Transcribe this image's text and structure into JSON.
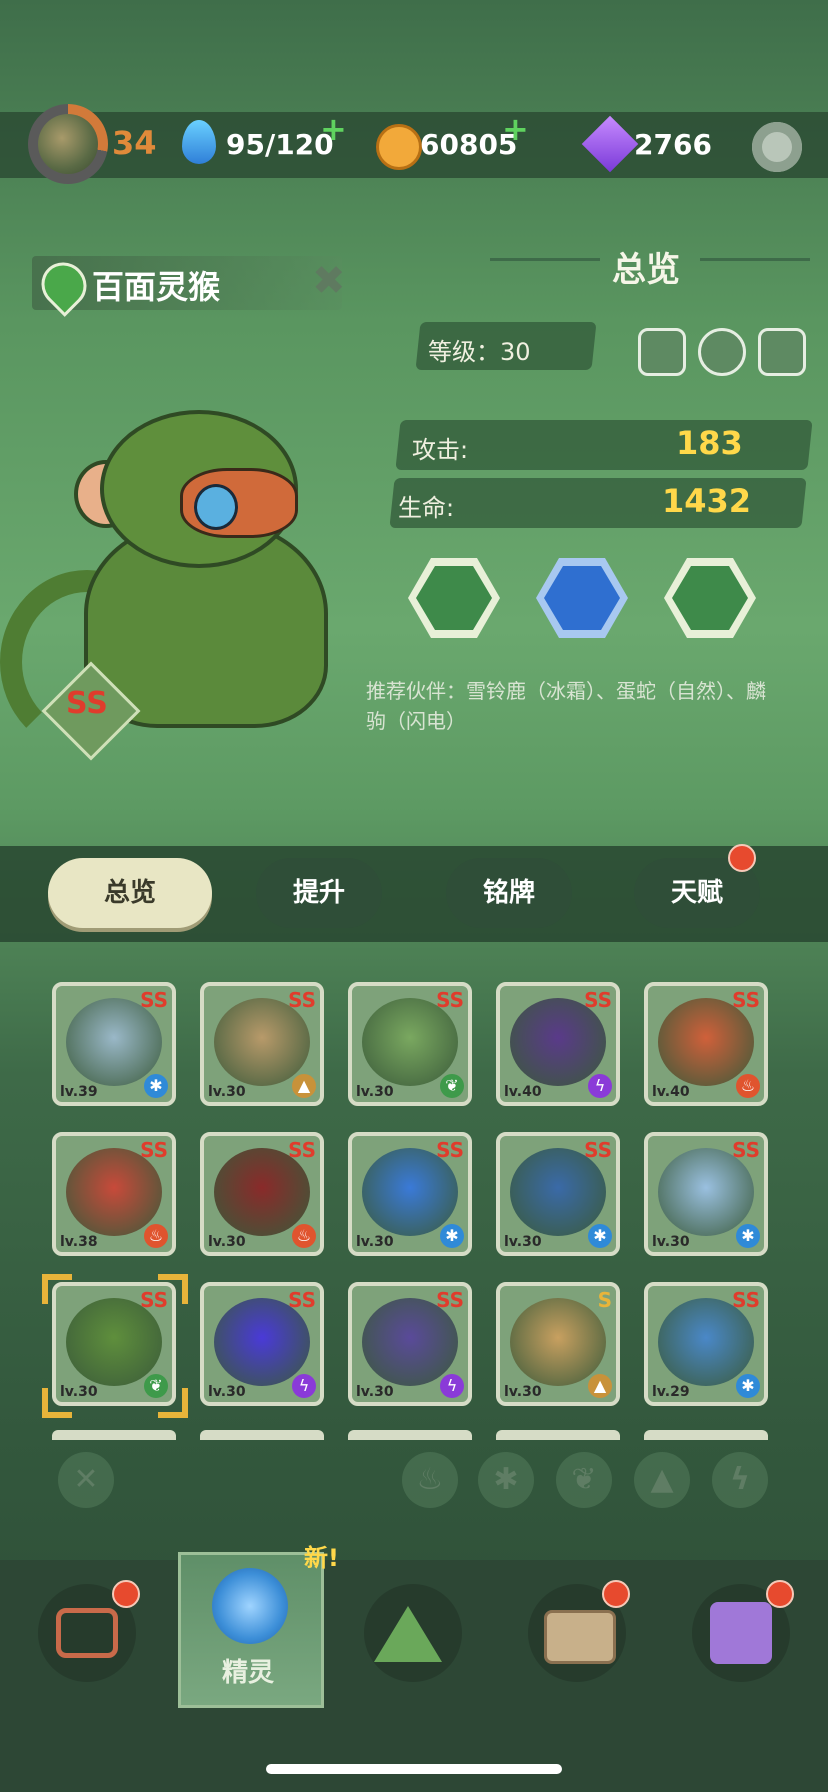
{
  "resources": {
    "level": "34",
    "stamina": "95/120",
    "coins": "60805",
    "gems": "2766"
  },
  "pet": {
    "name": "百面灵猴",
    "rank": "SS",
    "section_title": "总览",
    "level_label": "等级：30",
    "attack_label": "攻击:",
    "attack_value": "183",
    "hp_label": "生命:",
    "hp_value": "1432",
    "partners": "推荐伙伴：雪铃鹿（冰霜）、蛋蛇（自然）、麟驹（闪电）"
  },
  "tabs": [
    {
      "label": "总览"
    },
    {
      "label": "提升"
    },
    {
      "label": "铭牌"
    },
    {
      "label": "天赋"
    }
  ],
  "cards": [
    {
      "level": "lv.39",
      "rank": "SS",
      "element": "ice"
    },
    {
      "level": "lv.30",
      "rank": "SS",
      "element": "earth"
    },
    {
      "level": "lv.30",
      "rank": "SS",
      "element": "nature"
    },
    {
      "level": "lv.40",
      "rank": "SS",
      "element": "electric"
    },
    {
      "level": "lv.40",
      "rank": "SS",
      "element": "fire"
    },
    {
      "level": "lv.38",
      "rank": "SS",
      "element": "fire"
    },
    {
      "level": "lv.30",
      "rank": "SS",
      "element": "fire"
    },
    {
      "level": "lv.30",
      "rank": "SS",
      "element": "ice"
    },
    {
      "level": "lv.30",
      "rank": "SS",
      "element": "ice"
    },
    {
      "level": "lv.30",
      "rank": "SS",
      "element": "ice"
    },
    {
      "level": "lv.30",
      "rank": "SS",
      "element": "nature"
    },
    {
      "level": "lv.30",
      "rank": "SS",
      "element": "electric"
    },
    {
      "level": "lv.30",
      "rank": "SS",
      "element": "electric"
    },
    {
      "level": "lv.30",
      "rank": "S",
      "element": "earth"
    },
    {
      "level": "lv.29",
      "rank": "SS",
      "element": "ice"
    }
  ],
  "nav": {
    "spirit_label": "精灵",
    "new_badge": "新!"
  },
  "colors": {
    "accent_yellow": "#ffd84a",
    "notification_red": "#e74a2e",
    "rank_red": "#e03c2c"
  }
}
